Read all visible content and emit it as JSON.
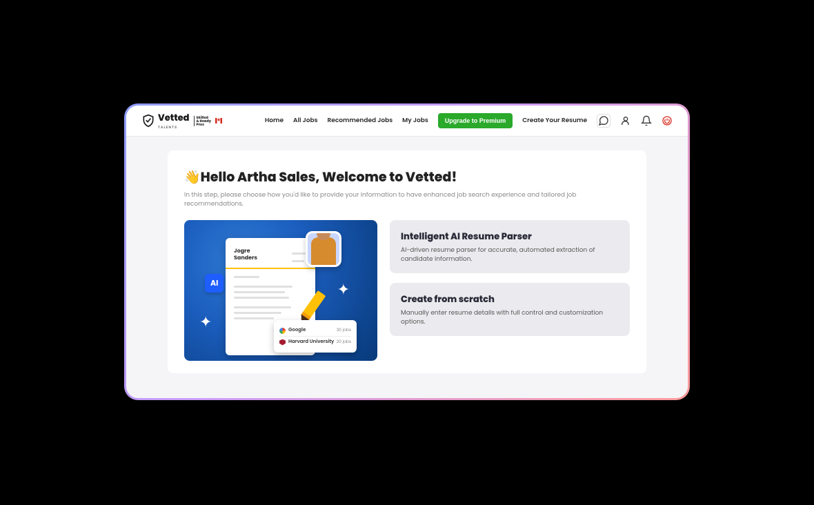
{
  "brand": {
    "name": "Vetted",
    "sub": "TALENTS",
    "tag1": "Skilled",
    "tag2": "& Ready",
    "tag3": "Pros"
  },
  "nav": {
    "home": "Home",
    "allJobs": "All Jobs",
    "recommended": "Recommended Jobs",
    "myJobs": "My Jobs",
    "premium": "Upgrade to Premium",
    "createResume": "Create Your Resume"
  },
  "welcome": {
    "title": "Hello Artha Sales, Welcome to Vetted!",
    "sub": "In this step, please choose how you'd like to provide your information to have enhanced job search experience and tailored job recommendations."
  },
  "illus": {
    "aiTag": "AI",
    "firstName": "Jogre",
    "lastName": "Sanders",
    "google": "Google",
    "googleJobs": "30 jobs",
    "harvard": "Harvard University",
    "harvardJobs": "20 jobs"
  },
  "options": {
    "ai": {
      "title": "Intelligent AI Resume Parser",
      "desc": "AI-driven resume parser for accurate, automated extraction of candidate information."
    },
    "scratch": {
      "title": "Create from scratch",
      "desc": "Manually enter resume details with full control and customization options."
    }
  }
}
